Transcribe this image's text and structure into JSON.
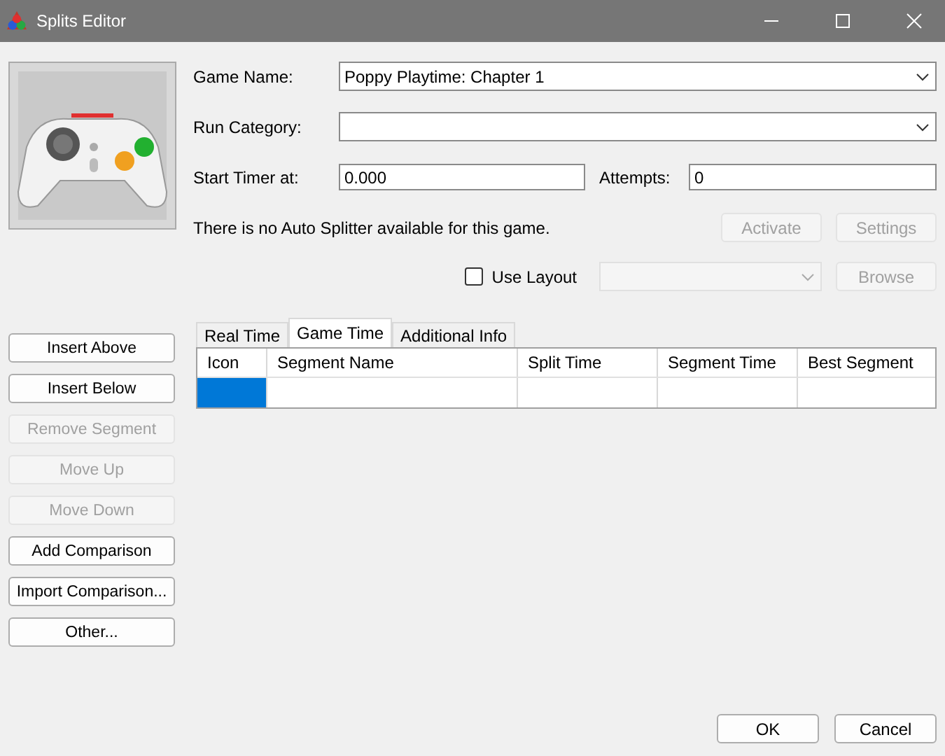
{
  "window": {
    "title": "Splits Editor"
  },
  "game_icon": {
    "kind": "picture"
  },
  "game_name": {
    "label": "Game Name:",
    "value": "Poppy Playtime: Chapter 1"
  },
  "run_category": {
    "label": "Run Category:"
  },
  "start_timer": {
    "label": "Start Timer at:",
    "value": "0.000"
  },
  "attempts": {
    "label": "Attempts:",
    "value": "0"
  },
  "auto_splitter": {
    "message": "There is no Auto Splitter available for this game.",
    "buttons": [
      {
        "label": "Activate",
        "disabled": true
      },
      {
        "label": "Settings",
        "disabled": true
      }
    ]
  },
  "layout": {
    "label": "Use Layout",
    "checked": false,
    "dropdown_disabled": true,
    "browse": {
      "label": "Browse",
      "disabled": true
    }
  },
  "side_buttons": [
    {
      "label": "Insert Above",
      "disabled": false
    },
    {
      "label": "Insert Below",
      "disabled": false
    },
    {
      "label": "Remove Segment",
      "disabled": true
    },
    {
      "label": "Move Up",
      "disabled": true
    },
    {
      "label": "Move Down",
      "disabled": true
    },
    {
      "label": "Add Comparison",
      "disabled": false
    },
    {
      "label": "Import Comparison...",
      "disabled": false
    },
    {
      "label": "Other...",
      "disabled": false
    }
  ],
  "tabs": [
    {
      "label": "Real Time",
      "selected": false
    },
    {
      "label": "Game Time",
      "selected": true
    },
    {
      "label": "Additional Info",
      "selected": false
    }
  ],
  "table": {
    "columns": [
      "Icon",
      "Segment Name",
      "Split Time",
      "Segment Time",
      "Best Segment"
    ],
    "rows": [
      {
        "selected": true
      }
    ]
  },
  "footer_buttons": [
    "OK",
    "Cancel"
  ]
}
